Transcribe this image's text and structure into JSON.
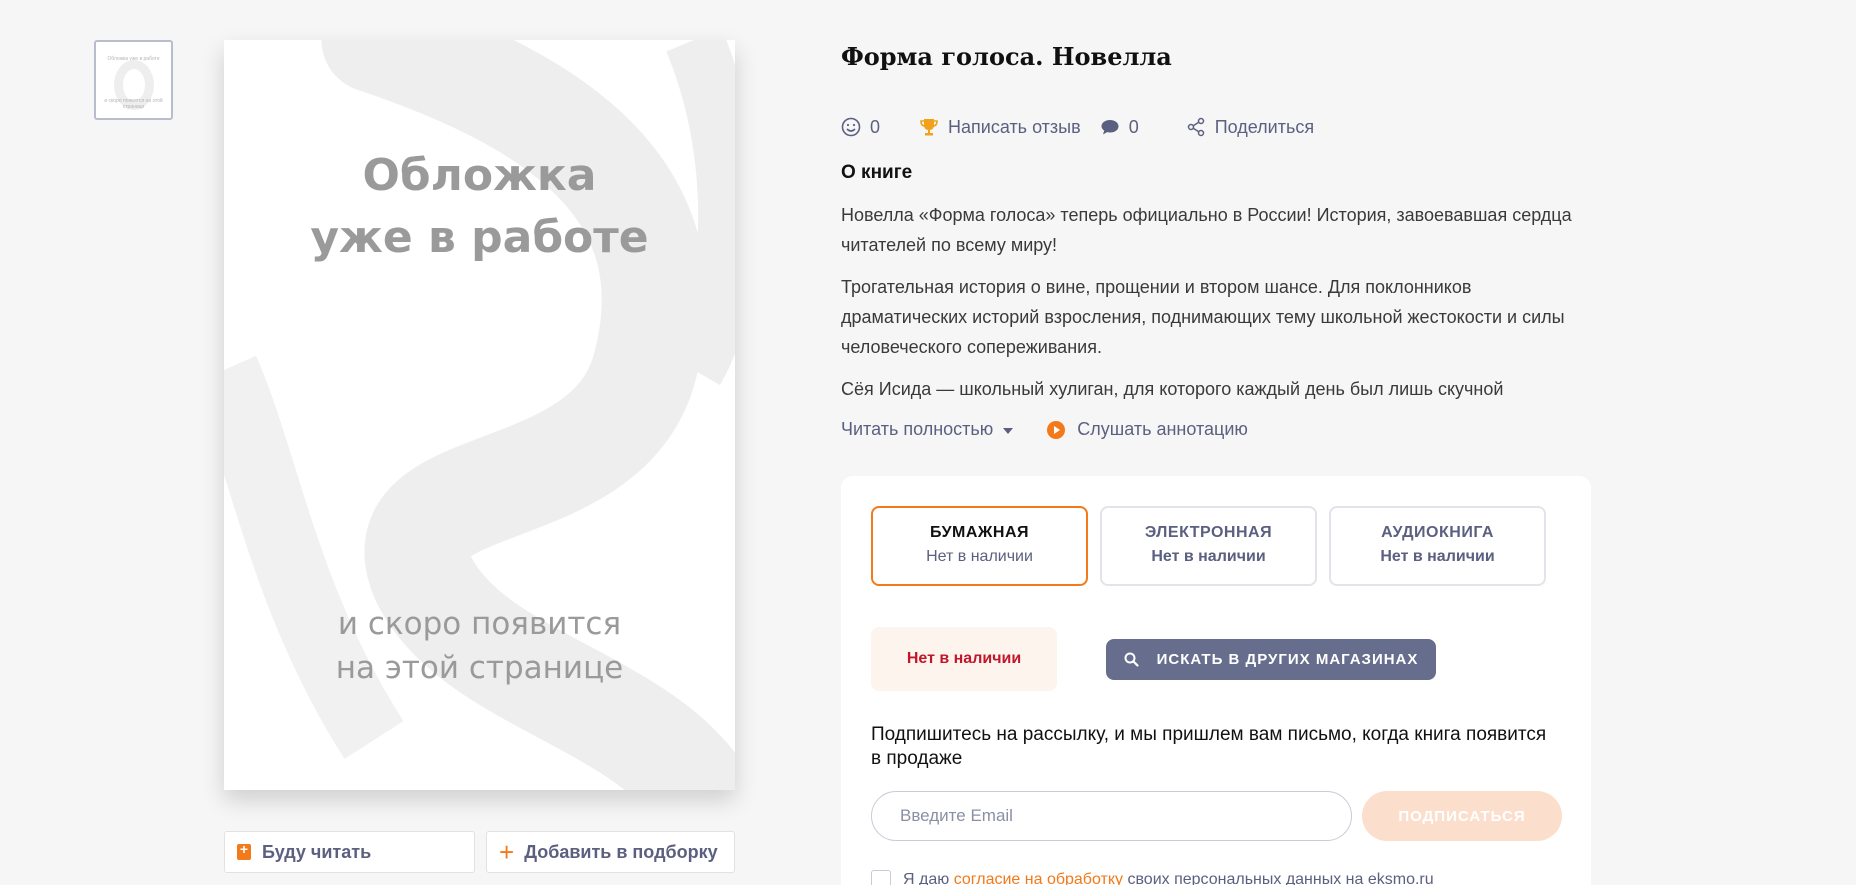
{
  "thumbnail": {
    "line1": "Обложка уже в работе",
    "line2": "и скоро появится на этой странице"
  },
  "cover": {
    "top_line1": "Обложка",
    "top_line2": "уже в работе",
    "bottom_line1": "и скоро появится",
    "bottom_line2": "на этой странице"
  },
  "cover_actions": {
    "read_label": "Буду читать",
    "add_label": "Добавить в подборку"
  },
  "book": {
    "title": "Форма голоса. Новелла",
    "likes_count": "0",
    "review_label": "Написать отзыв",
    "comments_count": "0",
    "share_label": "Поделиться"
  },
  "about": {
    "title": "О книге",
    "paragraphs": [
      "Новелла «Форма голоса» теперь официально в России! История, завоевавшая сердца читателей по всему миру!",
      "Трогательная история о вине, прощении и втором шансе. Для поклонников драматических историй взросления, поднимающих тему школьной жестокости и силы человеческого сопереживания.",
      "Сёя Исида — школьный хулиган, для которого каждый день был лишь скучной"
    ],
    "read_more_label": "Читать полностью",
    "listen_label": "Слушать аннотацию"
  },
  "formats": [
    {
      "name": "БУМАЖНАЯ",
      "status": "Нет в наличии",
      "active": true
    },
    {
      "name": "ЭЛЕКТРОННАЯ",
      "status": "Нет в наличии",
      "active": false
    },
    {
      "name": "АУДИОКНИГА",
      "status": "Нет в наличии",
      "active": false
    }
  ],
  "availability": {
    "badge": "Нет в наличии",
    "search_button": "ИСКАТЬ В ДРУГИХ МАГАЗИНАХ"
  },
  "subscribe": {
    "text": "Подпишитесь на рассылку, и мы пришлем вам письмо, когда книга появится в продаже",
    "email_placeholder": "Введите Email",
    "button": "ПОДПИСАТЬСЯ",
    "consent_prefix": "Я даю ",
    "consent_link": "согласие на обработку",
    "consent_suffix": " своих персональных данных на eksmo.ru"
  },
  "colors": {
    "accent": "#f27a1a",
    "muted_text": "#5c6080",
    "out_of_stock": "#c0182a",
    "search_button_bg": "#676d8c"
  },
  "icons": [
    "smile-icon",
    "trophy-icon",
    "comment-icon",
    "share-icon",
    "caret-down-icon",
    "play-icon",
    "search-icon",
    "bookmark-plus-icon",
    "plus-icon"
  ]
}
